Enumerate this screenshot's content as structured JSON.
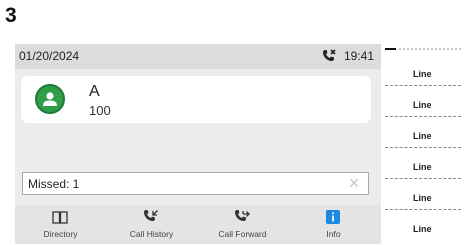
{
  "step_number": "3",
  "status_bar": {
    "date": "01/20/2024",
    "time": "19:41",
    "icon": "missed-call-icon"
  },
  "account": {
    "name": "A",
    "number": "100",
    "avatar_color": "#2e9e4a"
  },
  "notification": {
    "text": "Missed: 1",
    "dismiss_icon": "close-icon"
  },
  "softkeys": [
    {
      "label": "Directory",
      "icon": "book-icon"
    },
    {
      "label": "Call History",
      "icon": "call-history-icon"
    },
    {
      "label": "Call Forward",
      "icon": "call-forward-icon"
    },
    {
      "label": "Info",
      "icon": "info-icon",
      "accent": "#1e88e5"
    }
  ],
  "line_keys": [
    {
      "label": "Line"
    },
    {
      "label": "Line"
    },
    {
      "label": "Line"
    },
    {
      "label": "Line"
    },
    {
      "label": "Line"
    },
    {
      "label": "Line"
    }
  ]
}
